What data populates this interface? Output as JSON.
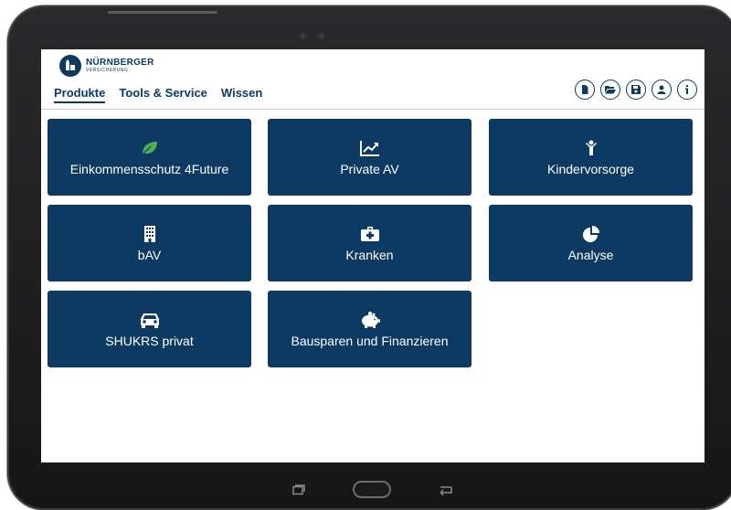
{
  "brand": {
    "name": "NÜRNBERGER",
    "sub": "VERSICHERUNG"
  },
  "nav": {
    "tabs": [
      {
        "label": "Produkte",
        "active": true
      },
      {
        "label": "Tools & Service",
        "active": false
      },
      {
        "label": "Wissen",
        "active": false
      }
    ]
  },
  "toolbar": {
    "buttons": [
      {
        "icon": "document-icon"
      },
      {
        "icon": "folder-open-icon"
      },
      {
        "icon": "save-icon"
      },
      {
        "icon": "user-icon"
      },
      {
        "icon": "info-icon"
      }
    ]
  },
  "tiles": [
    {
      "label": "Einkommensschutz 4Future",
      "icon": "leaf-icon"
    },
    {
      "label": "Private AV",
      "icon": "line-chart-icon"
    },
    {
      "label": "Kindervorsorge",
      "icon": "child-icon"
    },
    {
      "label": "bAV",
      "icon": "building-icon"
    },
    {
      "label": "Kranken",
      "icon": "medical-kit-icon"
    },
    {
      "label": "Analyse",
      "icon": "pie-chart-icon"
    },
    {
      "label": "SHUKRS privat",
      "icon": "car-icon"
    },
    {
      "label": "Bausparen und Finanzieren",
      "icon": "piggy-bank-icon"
    }
  ],
  "colors": {
    "brand_navy": "#0d3a63",
    "leaf_green": "#4caf50",
    "tablet_frame": "#1c1c1d"
  }
}
